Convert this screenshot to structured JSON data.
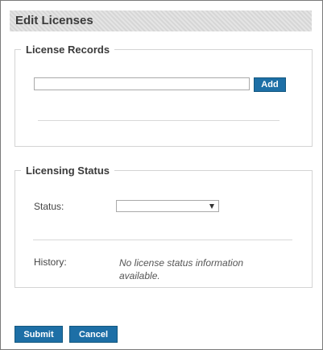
{
  "dialog": {
    "title": "Edit Licenses",
    "submit_label": "Submit",
    "cancel_label": "Cancel"
  },
  "license_records": {
    "legend": "License Records",
    "input_value": "",
    "add_label": "Add"
  },
  "licensing_status": {
    "legend": "Licensing Status",
    "status_label": "Status:",
    "status_selected": "",
    "history_label": "History:",
    "history_text": "No license status information available."
  },
  "icons": {
    "dropdown": "chevron-down-icon"
  }
}
